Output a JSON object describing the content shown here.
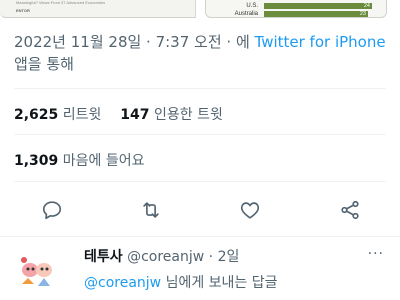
{
  "media": {
    "caption": "Meaningful? Views From 37 Advanced Economies",
    "source": "ENTOR",
    "rows": [
      {
        "country": "U.S.",
        "value": "24",
        "fraction": 0.24
      },
      {
        "country": "Australia",
        "value": "23",
        "fraction": 0.23
      }
    ]
  },
  "tweet": {
    "timestamp": "2022년 11월 28일 · 7:37 오전 · 에 ",
    "client": "Twitter for iPhone",
    "client_suffix": "앱을 통해",
    "retweets_count": "2,625",
    "retweets_label": "리트윗",
    "quotes_count": "147",
    "quotes_label": "인용한 트윗",
    "likes_count": "1,309",
    "likes_label": "마음에 들어요"
  },
  "actions": {
    "reply": "reply-icon",
    "retweet": "retweet-icon",
    "like": "heart-icon",
    "share": "share-icon"
  },
  "reply": {
    "name": "테투사",
    "handle": "@coreanjw",
    "separator": "·",
    "time": "2일",
    "more": "···",
    "reply_to_handle": "@coreanjw",
    "reply_to_suffix": " 님에게 보내는 답글"
  },
  "colors": {
    "link": "#1d9bf0",
    "muted": "#536471",
    "text": "#0f1419",
    "bar": "#6b8c3c"
  }
}
